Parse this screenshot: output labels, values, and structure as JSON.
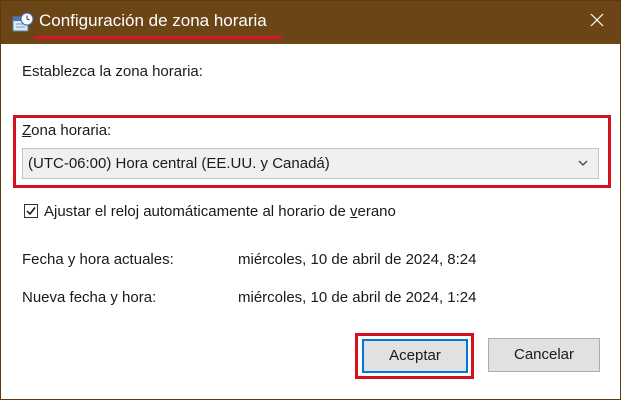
{
  "window": {
    "title": "Configuración de zona horaria",
    "app_icon": "clock-calendar-icon",
    "close_icon": "close-icon",
    "annotation_color": "#d4121f",
    "titlebar_color": "#6b4516"
  },
  "content": {
    "intro": "Establezca la zona horaria:",
    "timezone_label_first": "Z",
    "timezone_label_rest": "ona horaria:",
    "timezone_selected": "(UTC-06:00) Hora central (EE.UU. y Canadá)",
    "dst_checked": true,
    "dst_label_before": "Ajustar el reloj automáticamente al horario de ",
    "dst_label_accel": "v",
    "dst_label_after": "erano",
    "current_label": "Fecha y hora actuales:",
    "current_value": "miércoles, 10 de abril de 2024, 8:24",
    "new_label": "Nueva fecha y hora:",
    "new_value": "miércoles, 10 de abril de 2024, 1:24"
  },
  "buttons": {
    "accept": "Aceptar",
    "cancel": "Cancelar"
  }
}
